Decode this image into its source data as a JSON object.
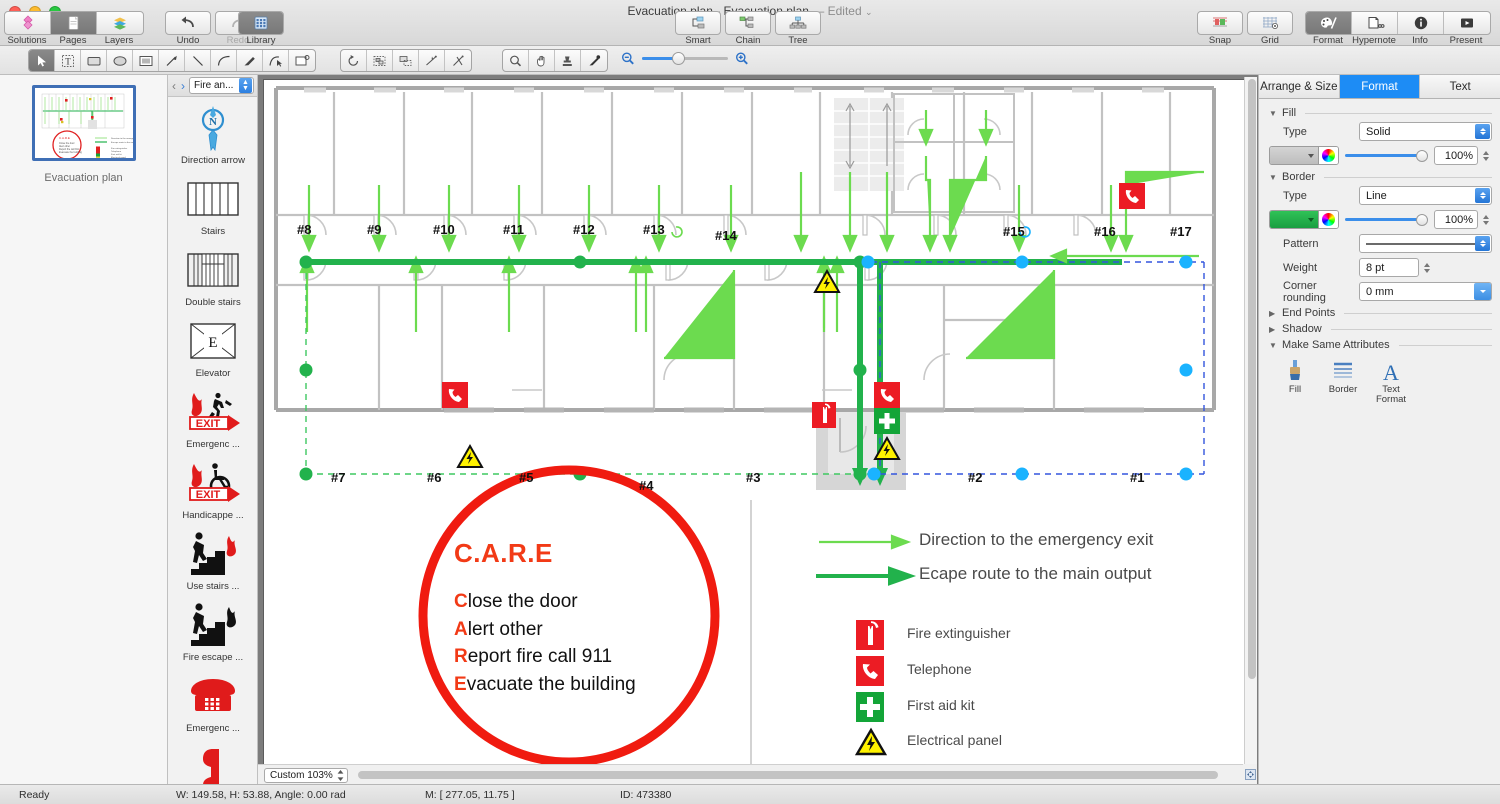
{
  "window": {
    "title_main": "Evacuation plan - Evacuation plan",
    "title_dash": "—",
    "title_state": "Edited",
    "chevron": "⌄"
  },
  "toolbar": {
    "left_group": [
      {
        "label": "Solutions",
        "icon": "solutions-icon",
        "active": false
      },
      {
        "label": "Pages",
        "icon": "pages-icon",
        "active": true
      },
      {
        "label": "Layers",
        "icon": "layers-icon",
        "active": false
      }
    ],
    "history_group": [
      {
        "label": "Undo",
        "icon": "undo-arrow-icon",
        "disabled": false
      },
      {
        "label": "Redo",
        "icon": "redo-arrow-icon",
        "disabled": true
      }
    ],
    "library_button": {
      "label": "Library",
      "icon": "library-grid-icon",
      "active": true
    },
    "connector_group": [
      {
        "label": "Smart",
        "icon": "smart-connector-icon"
      },
      {
        "label": "Chain",
        "icon": "chain-connector-icon"
      },
      {
        "label": "Tree",
        "icon": "tree-connector-icon"
      }
    ],
    "snap_group": [
      {
        "label": "Snap",
        "icon": "snap-icon"
      },
      {
        "label": "Grid",
        "icon": "grid-icon"
      }
    ],
    "inspector_group": [
      {
        "label": "Format",
        "icon": "format-palette-icon",
        "active": true
      },
      {
        "label": "Hypernote",
        "icon": "hypernote-icon",
        "active": false
      },
      {
        "label": "Info",
        "icon": "info-icon",
        "active": false
      },
      {
        "label": "Present",
        "icon": "present-play-icon",
        "active": false
      }
    ]
  },
  "tools": {
    "primary": [
      {
        "name": "select-arrow-tool",
        "active": true
      },
      {
        "name": "text-tool",
        "active": false
      },
      {
        "name": "rectangle-tool",
        "active": false
      },
      {
        "name": "ellipse-tool",
        "active": false
      },
      {
        "name": "container-tool",
        "active": false
      },
      {
        "name": "arrow-line-tool",
        "active": false
      },
      {
        "name": "straight-line-tool",
        "active": false
      },
      {
        "name": "curve-line-tool",
        "active": false
      },
      {
        "name": "pen-tool",
        "active": false
      },
      {
        "name": "bezier-edit-tool",
        "active": false
      },
      {
        "name": "callout-tool",
        "active": false
      }
    ],
    "secondary": [
      {
        "name": "rotate-tool"
      },
      {
        "name": "group-tool"
      },
      {
        "name": "ungroup-tool"
      },
      {
        "name": "smart-line-tool"
      },
      {
        "name": "cut-path-tool"
      }
    ],
    "view": [
      {
        "name": "zoom-tool"
      },
      {
        "name": "hand-pan-tool"
      },
      {
        "name": "stamp-tool"
      },
      {
        "name": "eyedropper-tool"
      }
    ],
    "zoom_out_icon": "zoom-out-icon",
    "zoom_in_icon": "zoom-in-icon"
  },
  "pages": {
    "selected_page_label": "Evacuation plan"
  },
  "library": {
    "back_icon": "chevron-left-icon",
    "forward_icon": "chevron-right-icon",
    "category": "Fire an...",
    "items": [
      {
        "label": "Direction arrow",
        "icon": "compass-direction-arrow-icon"
      },
      {
        "label": "Stairs",
        "icon": "stairs-icon"
      },
      {
        "label": "Double stairs",
        "icon": "double-stairs-icon"
      },
      {
        "label": "Elevator",
        "icon": "elevator-icon"
      },
      {
        "label": "Emergenc ...",
        "icon": "emergency-exit-icon"
      },
      {
        "label": "Handicappe ...",
        "icon": "handicapped-exit-icon"
      },
      {
        "label": "Use stairs  ...",
        "icon": "use-stairs-icon"
      },
      {
        "label": "Fire escape  ...",
        "icon": "fire-escape-icon"
      },
      {
        "label": "Emergenc ...",
        "icon": "emergency-telephone-icon"
      },
      {
        "label": "",
        "icon": "telephone-handset-icon"
      }
    ]
  },
  "inspector": {
    "tabs": [
      {
        "label": "Arrange & Size",
        "active": false
      },
      {
        "label": "Format",
        "active": true
      },
      {
        "label": "Text",
        "active": false
      }
    ],
    "fill": {
      "section": "Fill",
      "type_label": "Type",
      "type_value": "Solid",
      "color": "#c8c8c8",
      "opacity": "100%"
    },
    "border": {
      "section": "Border",
      "type_label": "Type",
      "type_value": "Line",
      "color": "#22b24c",
      "opacity": "100%",
      "pattern_label": "Pattern",
      "pattern_value": "solid-line",
      "weight_label": "Weight",
      "weight_value": "8 pt",
      "corner_label": "Corner rounding",
      "corner_value": "0 mm"
    },
    "end_points": {
      "section": "End Points"
    },
    "shadow": {
      "section": "Shadow"
    },
    "make_same": {
      "section": "Make Same Attributes",
      "items": [
        {
          "label": "Fill",
          "icon": "fill-brush-icon"
        },
        {
          "label": "Border",
          "icon": "border-lines-icon"
        },
        {
          "label": "Text\nFormat",
          "icon": "text-format-a-icon"
        }
      ]
    }
  },
  "canvas": {
    "zoom_value": "Custom 103%",
    "fit_icon": "fit-to-window-icon"
  },
  "status": {
    "ready": "Ready",
    "size": "W: 149.58,  H: 53.88,  Angle: 0.00 rad",
    "mouse": "M: [ 277.05, 11.75 ]",
    "id": "ID: 473380"
  },
  "plan": {
    "room_labels_top": [
      "#8",
      "#9",
      "#10",
      "#11",
      "#12",
      "#13",
      "#14",
      "#15",
      "#16",
      "#17"
    ],
    "room_labels_bottom": [
      "#7",
      "#6",
      "#5",
      "#4",
      "#3",
      "#2",
      "#1"
    ],
    "care": {
      "title": "C.A.R.E",
      "lines": [
        {
          "initial": "C",
          "rest": "lose the door"
        },
        {
          "initial": "A",
          "rest": "lert other"
        },
        {
          "initial": "R",
          "rest": "eport fire call 911"
        },
        {
          "initial": "E",
          "rest": "vacuate the building"
        }
      ]
    },
    "legend_routes": [
      {
        "label": "Direction to the emergency exit",
        "style": "thin-light-green-arrow"
      },
      {
        "label": "Ecape route to the main output",
        "style": "thick-green-arrow"
      }
    ],
    "legend_symbols": [
      {
        "label": "Fire extinguisher",
        "icon": "fire-extinguisher-icon",
        "color": "#ec1c24"
      },
      {
        "label": "Telephone",
        "icon": "telephone-icon",
        "color": "#ec1c24"
      },
      {
        "label": "First aid kit",
        "icon": "first-aid-kit-icon",
        "color": "#13a538"
      },
      {
        "label": "Electrical panel",
        "icon": "electrical-panel-icon",
        "color": "#fff200"
      }
    ]
  },
  "colors": {
    "accent_blue": "#1d8cf5",
    "route_green": "#22b24c",
    "direction_green": "#6cdb4f",
    "alert_red": "#ec1c24",
    "warning_yellow": "#fff200",
    "selection_blue": "#1ab3ff"
  }
}
